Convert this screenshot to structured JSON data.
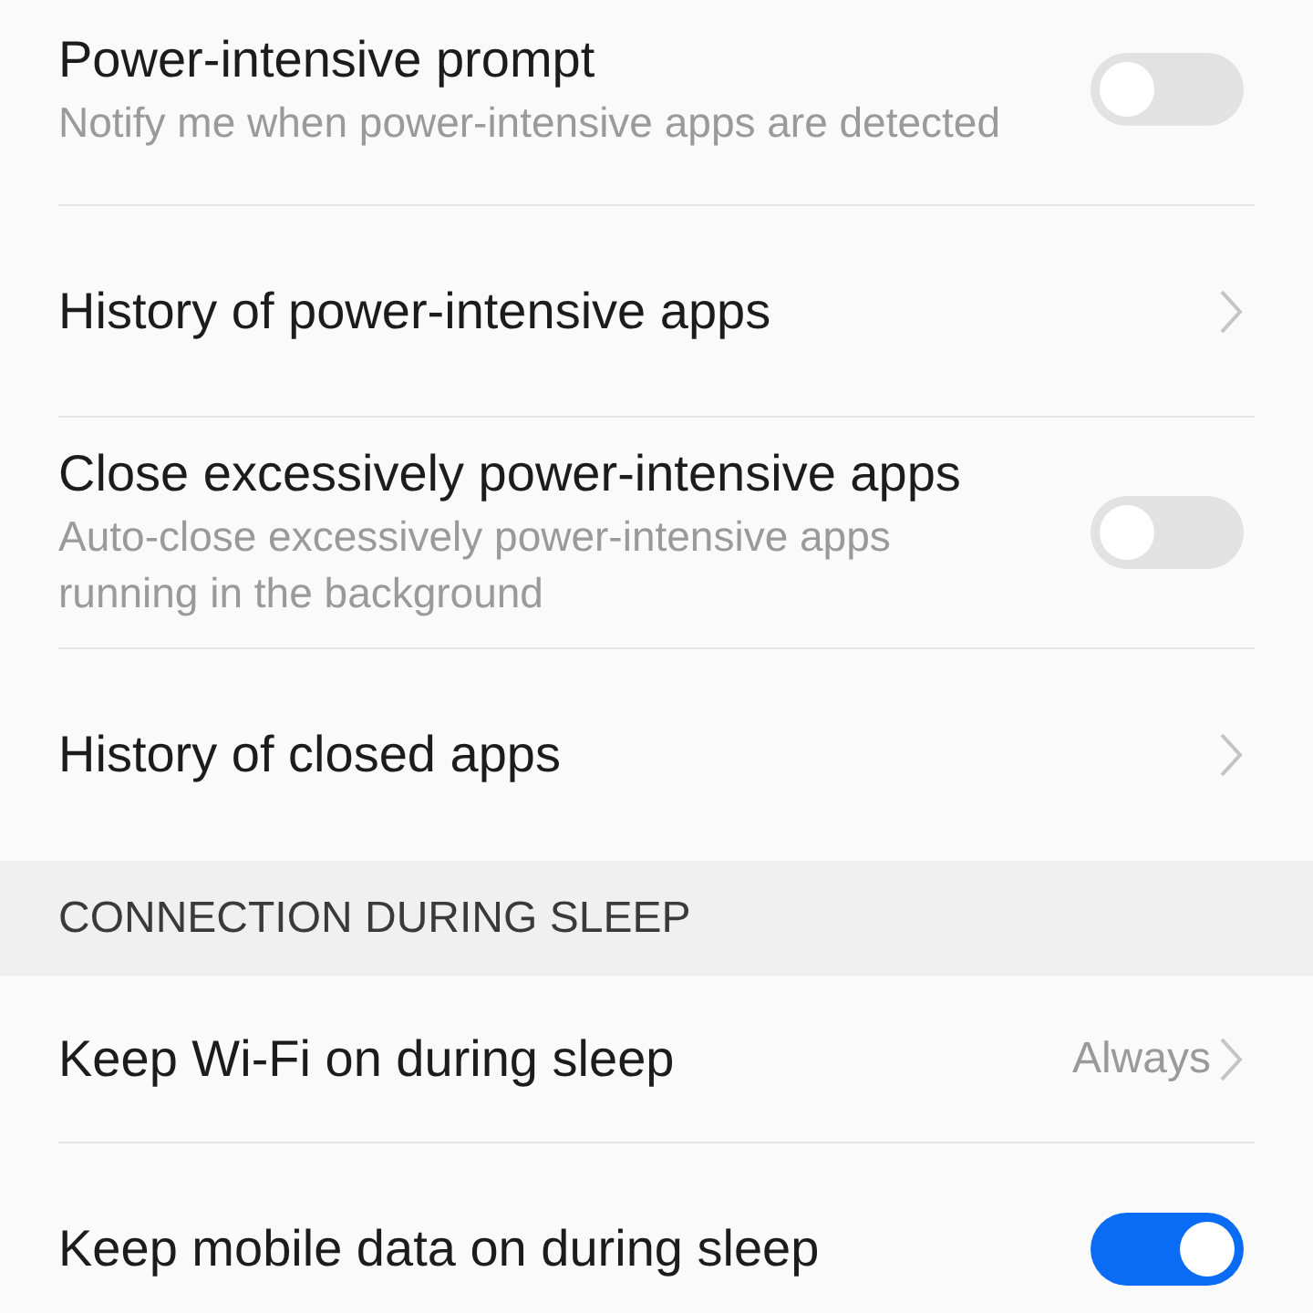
{
  "sections": [
    {
      "rows": [
        {
          "kind": "toggle",
          "title": "Power-intensive prompt",
          "subtitle": "Notify me when power-intensive apps are detected",
          "on": false
        },
        {
          "kind": "link",
          "title": "History of power-intensive apps"
        },
        {
          "kind": "toggle",
          "title": "Close excessively power-intensive apps",
          "subtitle": "Auto-close excessively power-intensive apps running in the background",
          "on": false
        },
        {
          "kind": "link",
          "title": "History of closed apps"
        }
      ]
    },
    {
      "header": "CONNECTION DURING SLEEP",
      "rows": [
        {
          "kind": "link",
          "title": "Keep Wi-Fi on during sleep",
          "value": "Always"
        },
        {
          "kind": "toggle",
          "title": "Keep mobile data on during sleep",
          "on": true
        }
      ]
    }
  ]
}
